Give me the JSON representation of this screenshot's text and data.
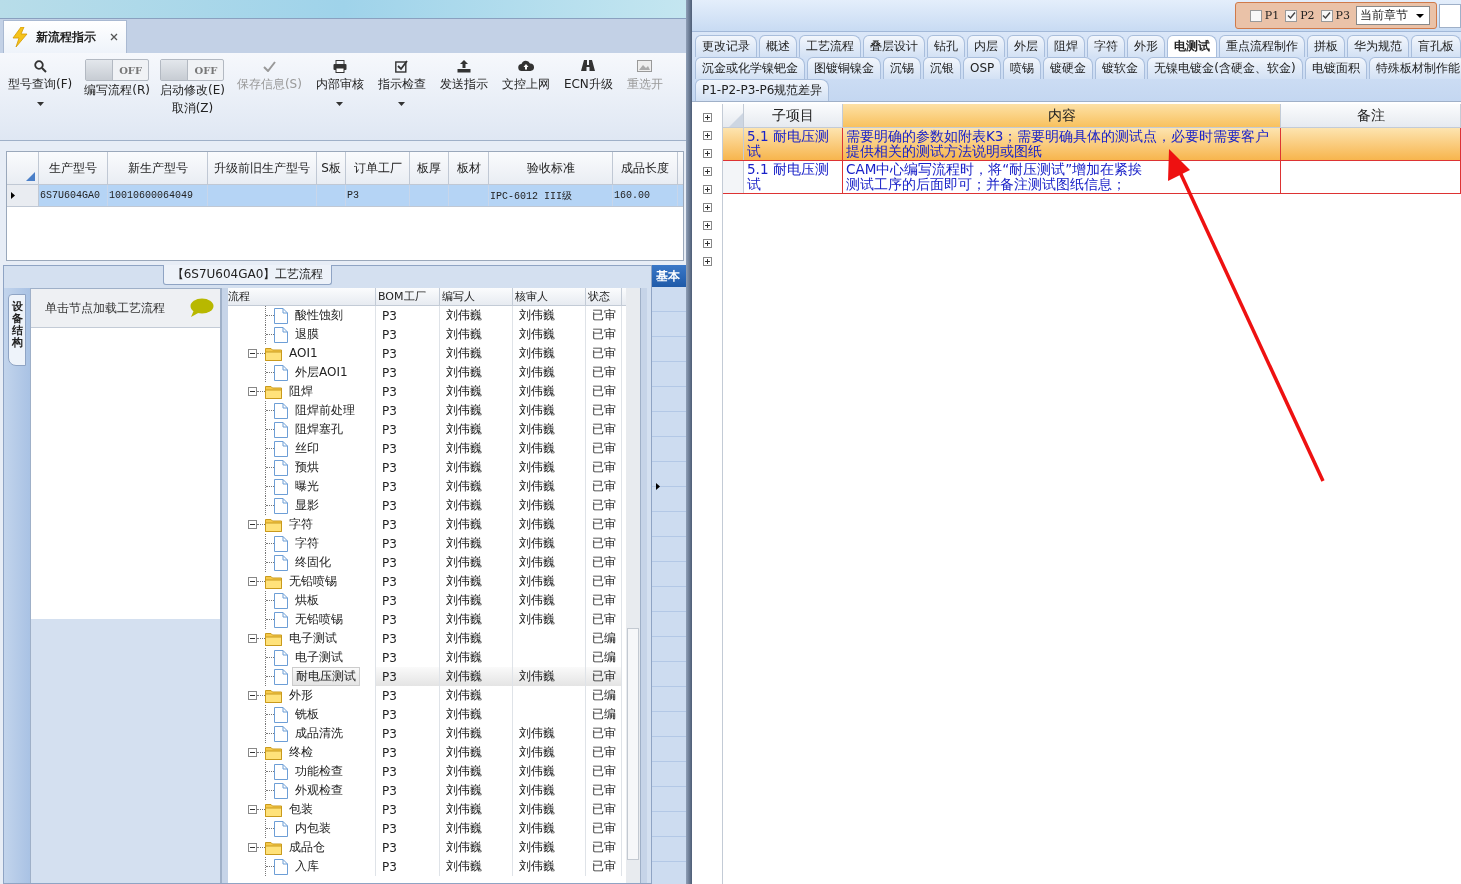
{
  "left_window": {
    "tab": {
      "label": "新流程指示",
      "selected": true
    },
    "toolbar": [
      {
        "kind": "button",
        "label": "型号查询(F)",
        "menu": true,
        "disabled": false
      },
      {
        "kind": "toggle",
        "label": "编写流程(R)",
        "state_text": "OFF",
        "on": false
      },
      {
        "kind": "toggle",
        "label": "启动修改(E)",
        "sublabel": "取消(Z)",
        "state_text": "OFF",
        "on": false
      },
      {
        "kind": "button",
        "label": "保存信息(S)",
        "menu": false,
        "disabled": true
      },
      {
        "kind": "button",
        "label": "内部审核",
        "menu": true,
        "disabled": false
      },
      {
        "kind": "button",
        "label": "指示检查",
        "menu": true,
        "disabled": false
      },
      {
        "kind": "button",
        "label": "发送指示",
        "menu": false,
        "disabled": false
      },
      {
        "kind": "button",
        "label": "文控上网",
        "menu": false,
        "disabled": false
      },
      {
        "kind": "button",
        "label": "ECN升级",
        "menu": false,
        "disabled": false
      },
      {
        "kind": "button",
        "label": "重选开",
        "menu": false,
        "disabled": true
      }
    ],
    "grid": {
      "columns": [
        "生产型号",
        "新生产型号",
        "升级前旧生产型号",
        "S板",
        "订单工厂",
        "板厚",
        "板材",
        "验收标准",
        "成品长度"
      ],
      "rows": [
        {
          "cells": [
            "6S7U604GA0",
            "10010600064049",
            "",
            "",
            "P3",
            "",
            "",
            "IPC-6012 III级",
            "160.00"
          ],
          "selected": true
        }
      ]
    },
    "process_panel": {
      "title": "【6S7U604GA0】工艺流程",
      "side_tab": "设备结构",
      "hint": "单击节点加载工艺流程",
      "right_tab": "基本",
      "tree": {
        "columns": [
          "流程",
          "BOM工厂",
          "编写人",
          "核审人",
          "状态"
        ],
        "nodes": [
          {
            "children": [
              {
                "name": "酸性蚀刻",
                "factory": "P3",
                "writer": "刘伟巍",
                "reviewer": "刘伟巍",
                "status": "已审",
                "selected": false
              },
              {
                "name": "退膜",
                "factory": "P3",
                "writer": "刘伟巍",
                "reviewer": "刘伟巍",
                "status": "已审",
                "selected": false
              }
            ]
          },
          {
            "name": "AOI1",
            "factory": "P3",
            "writer": "刘伟巍",
            "reviewer": "刘伟巍",
            "status": "已审",
            "selected": false,
            "expanded": true,
            "children": [
              {
                "name": "外层AOI1",
                "factory": "P3",
                "writer": "刘伟巍",
                "reviewer": "刘伟巍",
                "status": "已审",
                "selected": false
              }
            ]
          },
          {
            "name": "阻焊",
            "factory": "P3",
            "writer": "刘伟巍",
            "reviewer": "刘伟巍",
            "status": "已审",
            "selected": false,
            "expanded": true,
            "children": [
              {
                "name": "阻焊前处理",
                "factory": "P3",
                "writer": "刘伟巍",
                "reviewer": "刘伟巍",
                "status": "已审",
                "selected": false
              },
              {
                "name": "阻焊塞孔",
                "factory": "P3",
                "writer": "刘伟巍",
                "reviewer": "刘伟巍",
                "status": "已审",
                "selected": false
              },
              {
                "name": "丝印",
                "factory": "P3",
                "writer": "刘伟巍",
                "reviewer": "刘伟巍",
                "status": "已审",
                "selected": false
              },
              {
                "name": "预烘",
                "factory": "P3",
                "writer": "刘伟巍",
                "reviewer": "刘伟巍",
                "status": "已审",
                "selected": false
              },
              {
                "name": "曝光",
                "factory": "P3",
                "writer": "刘伟巍",
                "reviewer": "刘伟巍",
                "status": "已审",
                "selected": false
              },
              {
                "name": "显影",
                "factory": "P3",
                "writer": "刘伟巍",
                "reviewer": "刘伟巍",
                "status": "已审",
                "selected": false
              }
            ]
          },
          {
            "name": "字符",
            "factory": "P3",
            "writer": "刘伟巍",
            "reviewer": "刘伟巍",
            "status": "已审",
            "selected": false,
            "expanded": true,
            "children": [
              {
                "name": "字符",
                "factory": "P3",
                "writer": "刘伟巍",
                "reviewer": "刘伟巍",
                "status": "已审",
                "selected": false
              },
              {
                "name": "终固化",
                "factory": "P3",
                "writer": "刘伟巍",
                "reviewer": "刘伟巍",
                "status": "已审",
                "selected": false
              }
            ]
          },
          {
            "name": "无铅喷锡",
            "factory": "P3",
            "writer": "刘伟巍",
            "reviewer": "刘伟巍",
            "status": "已审",
            "selected": false,
            "expanded": true,
            "children": [
              {
                "name": "烘板",
                "factory": "P3",
                "writer": "刘伟巍",
                "reviewer": "刘伟巍",
                "status": "已审",
                "selected": false
              },
              {
                "name": "无铅喷锡",
                "factory": "P3",
                "writer": "刘伟巍",
                "reviewer": "刘伟巍",
                "status": "已审",
                "selected": false
              }
            ]
          },
          {
            "name": "电子测试",
            "factory": "P3",
            "writer": "刘伟巍",
            "status": "已编",
            "selected": false,
            "expanded": true,
            "children": [
              {
                "name": "电子测试",
                "factory": "P3",
                "writer": "刘伟巍",
                "status": "已编",
                "selected": false
              },
              {
                "name": "耐电压测试",
                "factory": "P3",
                "writer": "刘伟巍",
                "reviewer": "刘伟巍",
                "status": "已审",
                "selected": true
              }
            ]
          },
          {
            "name": "外形",
            "factory": "P3",
            "writer": "刘伟巍",
            "status": "已编",
            "selected": false,
            "expanded": true,
            "children": [
              {
                "name": "铣板",
                "factory": "P3",
                "writer": "刘伟巍",
                "status": "已编",
                "selected": false
              },
              {
                "name": "成品清洗",
                "factory": "P3",
                "writer": "刘伟巍",
                "reviewer": "刘伟巍",
                "status": "已审",
                "selected": false
              }
            ]
          },
          {
            "name": "终检",
            "factory": "P3",
            "writer": "刘伟巍",
            "reviewer": "刘伟巍",
            "status": "已审",
            "selected": false,
            "expanded": true,
            "children": [
              {
                "name": "功能检查",
                "factory": "P3",
                "writer": "刘伟巍",
                "reviewer": "刘伟巍",
                "status": "已审",
                "selected": false
              },
              {
                "name": "外观检查",
                "factory": "P3",
                "writer": "刘伟巍",
                "reviewer": "刘伟巍",
                "status": "已审",
                "selected": false
              }
            ]
          },
          {
            "name": "包装",
            "factory": "P3",
            "writer": "刘伟巍",
            "reviewer": "刘伟巍",
            "status": "已审",
            "selected": false,
            "expanded": true,
            "children": [
              {
                "name": "内包装",
                "factory": "P3",
                "writer": "刘伟巍",
                "reviewer": "刘伟巍",
                "status": "已审",
                "selected": false
              }
            ]
          },
          {
            "name": "成品仓",
            "factory": "P3",
            "writer": "刘伟巍",
            "reviewer": "刘伟巍",
            "status": "已审",
            "selected": false,
            "expanded": true,
            "children": [
              {
                "name": "入库",
                "factory": "P3",
                "writer": "刘伟巍",
                "reviewer": "刘伟巍",
                "status": "已审",
                "selected": false
              }
            ]
          }
        ]
      }
    }
  },
  "right_window": {
    "filters": [
      {
        "label": "P1",
        "checked": false
      },
      {
        "label": "P2",
        "checked": true
      },
      {
        "label": "P3",
        "checked": true
      }
    ],
    "scope_select": {
      "value": "当前章节"
    },
    "tab_rows": [
      [
        {
          "label": "更改记录",
          "selected": false
        },
        {
          "label": "概述",
          "selected": false
        },
        {
          "label": "工艺流程",
          "selected": false
        },
        {
          "label": "叠层设计",
          "selected": false
        },
        {
          "label": "钻孔",
          "selected": false
        },
        {
          "label": "内层",
          "selected": false
        },
        {
          "label": "外层",
          "selected": false
        },
        {
          "label": "阻焊",
          "selected": false
        },
        {
          "label": "字符",
          "selected": false
        },
        {
          "label": "外形",
          "selected": false
        },
        {
          "label": "电测试",
          "selected": true
        },
        {
          "label": "重点流程制作",
          "selected": false
        },
        {
          "label": "拼板",
          "selected": false
        },
        {
          "label": "华为规范",
          "selected": false
        },
        {
          "label": "盲孔板",
          "selected": false
        }
      ],
      [
        {
          "label": "沉金或化学镍钯金",
          "selected": false
        },
        {
          "label": "图镀铜镍金",
          "selected": false
        },
        {
          "label": "沉锡",
          "selected": false
        },
        {
          "label": "沉银",
          "selected": false
        },
        {
          "label": "OSP",
          "selected": false
        },
        {
          "label": "喷锡",
          "selected": false
        },
        {
          "label": "镀硬金",
          "selected": false
        },
        {
          "label": "镀软金",
          "selected": false
        },
        {
          "label": "无镍电镀金(含硬金、软金)",
          "selected": false
        },
        {
          "label": "电镀面积",
          "selected": false
        },
        {
          "label": "特殊板材制作能",
          "selected": false
        }
      ],
      [
        {
          "label": "P1-P2-P3-P6规范差异",
          "selected": false
        }
      ]
    ],
    "grid": {
      "columns": [
        "子项目",
        "内容",
        "备注"
      ],
      "rows": [
        {
          "sub_item": "5.1 耐电压测试",
          "content": [
            "需要明确的参数如附表K3；需要明确具体的测试点，必要时需要客户提供相关的测试方法说明或图纸"
          ],
          "selected": true
        },
        {
          "sub_item": "5.1 耐电压测试",
          "content": [
            "CAM中心编写流程时，将“耐压测试”增加在紧挨",
            "测试工序的后",
            "面即可；并备注测试图纸信息；"
          ],
          "selected": false
        }
      ]
    }
  }
}
